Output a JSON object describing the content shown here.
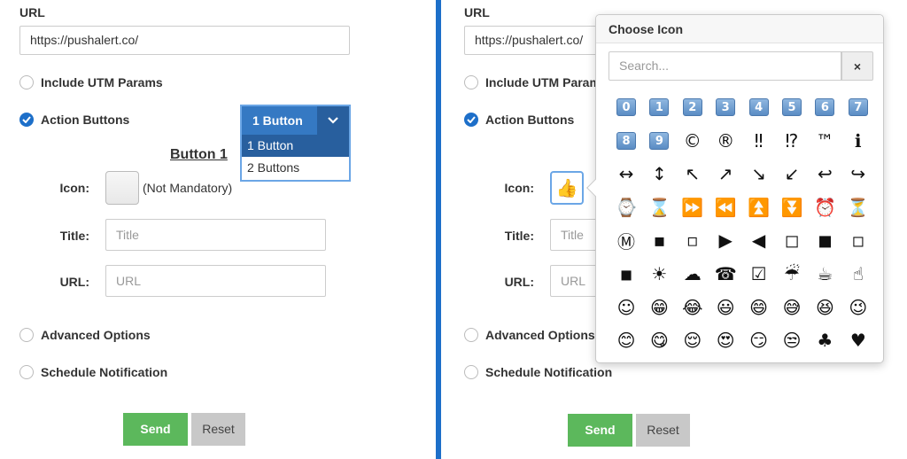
{
  "left": {
    "url_label": "URL",
    "url_value": "https://pushalert.co/",
    "utm_label": "Include UTM Params",
    "action_buttons_label": "Action Buttons",
    "dropdown": {
      "selected": "1 Button",
      "options": [
        "1 Button",
        "2 Buttons"
      ]
    },
    "button_heading": "Button 1",
    "icon_label": "Icon:",
    "icon_note": "(Not Mandatory)",
    "title_label": "Title:",
    "title_placeholder": "Title",
    "url_field_label": "URL:",
    "url_placeholder": "URL",
    "advanced_label": "Advanced Options",
    "schedule_label": "Schedule Notification",
    "send_label": "Send",
    "reset_label": "Reset"
  },
  "right": {
    "url_label": "URL",
    "url_value": "https://pushalert.co/",
    "utm_label": "Include UTM Params",
    "action_buttons_label": "Action Buttons",
    "icon_label": "Icon:",
    "selected_icon": "👍",
    "title_label": "Title:",
    "title_placeholder": "Title",
    "url_field_label": "URL:",
    "url_placeholder": "URL",
    "advanced_label": "Advanced Options",
    "schedule_label": "Schedule Notification",
    "send_label": "Send",
    "reset_label": "Reset",
    "popover": {
      "title": "Choose Icon",
      "search_placeholder": "Search...",
      "clear_icon": "×",
      "icons": [
        {
          "g": "0",
          "kind": "keycap"
        },
        {
          "g": "1",
          "kind": "keycap"
        },
        {
          "g": "2",
          "kind": "keycap"
        },
        {
          "g": "3",
          "kind": "keycap"
        },
        {
          "g": "4",
          "kind": "keycap"
        },
        {
          "g": "5",
          "kind": "keycap"
        },
        {
          "g": "6",
          "kind": "keycap"
        },
        {
          "g": "7",
          "kind": "keycap"
        },
        {
          "g": "8",
          "kind": "keycap"
        },
        {
          "g": "9",
          "kind": "keycap"
        },
        {
          "g": "©"
        },
        {
          "g": "®"
        },
        {
          "g": "‼"
        },
        {
          "g": "⁉"
        },
        {
          "g": "™"
        },
        {
          "g": "ℹ"
        },
        {
          "g": "↔"
        },
        {
          "g": "↕"
        },
        {
          "g": "↖"
        },
        {
          "g": "↗"
        },
        {
          "g": "↘"
        },
        {
          "g": "↙"
        },
        {
          "g": "↩"
        },
        {
          "g": "↪"
        },
        {
          "g": "⌚"
        },
        {
          "g": "⌛"
        },
        {
          "g": "⏩"
        },
        {
          "g": "⏪"
        },
        {
          "g": "⏫"
        },
        {
          "g": "⏬"
        },
        {
          "g": "⏰"
        },
        {
          "g": "⏳"
        },
        {
          "g": "Ⓜ"
        },
        {
          "g": "▪"
        },
        {
          "g": "▫"
        },
        {
          "g": "▶"
        },
        {
          "g": "◀"
        },
        {
          "g": "◻"
        },
        {
          "g": "◼"
        },
        {
          "g": "◽"
        },
        {
          "g": "◾"
        },
        {
          "g": "☀"
        },
        {
          "g": "☁"
        },
        {
          "g": "☎"
        },
        {
          "g": "☑"
        },
        {
          "g": "☔"
        },
        {
          "g": "☕"
        },
        {
          "g": "☝"
        },
        {
          "g": "☺"
        },
        {
          "g": "😁"
        },
        {
          "g": "😂"
        },
        {
          "g": "😃"
        },
        {
          "g": "😄"
        },
        {
          "g": "😅"
        },
        {
          "g": "😆"
        },
        {
          "g": "😉"
        },
        {
          "g": "😊"
        },
        {
          "g": "😋"
        },
        {
          "g": "😌"
        },
        {
          "g": "😍"
        },
        {
          "g": "😏"
        },
        {
          "g": "😒"
        },
        {
          "g": "♣"
        },
        {
          "g": "♥"
        }
      ]
    }
  },
  "colors": {
    "accent": "#1d6fc9",
    "send": "#5cb85c",
    "reset": "#c8c8c8",
    "dropdown_header": "#3579c3",
    "dropdown_active": "#285f9e"
  }
}
